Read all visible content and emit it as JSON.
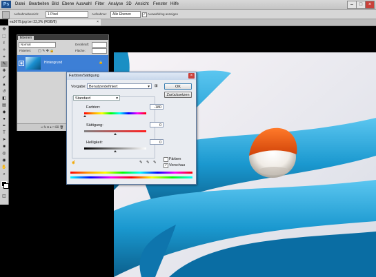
{
  "app": {
    "logo": "Ps"
  },
  "menu": [
    "Datei",
    "Bearbeiten",
    "Bild",
    "Ebene",
    "Auswahl",
    "Filter",
    "Analyse",
    "3D",
    "Ansicht",
    "Fenster",
    "Hilfe"
  ],
  "options_bar": {
    "aufnahmebereich_label": "Aufnahmebereich:",
    "aufnahmebereich_value": "1 Pixel",
    "aufnahme_label": "Aufnahme:",
    "aufnahme_value": "Alle Ebenen",
    "show_ring_label": "Auswahlring anzeigen"
  },
  "document": {
    "tab_title": "ea3679.jpg bei 33,3% (RGB/8)",
    "close": "×"
  },
  "layers_panel": {
    "tab": "Ebenen",
    "blend_mode": "Normal",
    "opacity_label": "Deckkraft:",
    "fix_label": "Fixieren:",
    "fill_label": "Fläche:",
    "layer_name": "Hintergrund",
    "footer": "∞  fx  ◘  ●  □  ⌧  🗑"
  },
  "dialog": {
    "title": "Farbton/Sättigung",
    "preset_label": "Vorgabe:",
    "preset_value": "Benutzerdefiniert",
    "ok": "OK",
    "reset": "Zurücksetzen",
    "channel": "Standard",
    "hue_label": "Farbton:",
    "hue_value": "-180",
    "sat_label": "Sättigung:",
    "sat_value": "0",
    "light_label": "Helligkeit:",
    "light_value": "0",
    "colorize_label": "Färben",
    "preview_label": "Vorschau"
  }
}
